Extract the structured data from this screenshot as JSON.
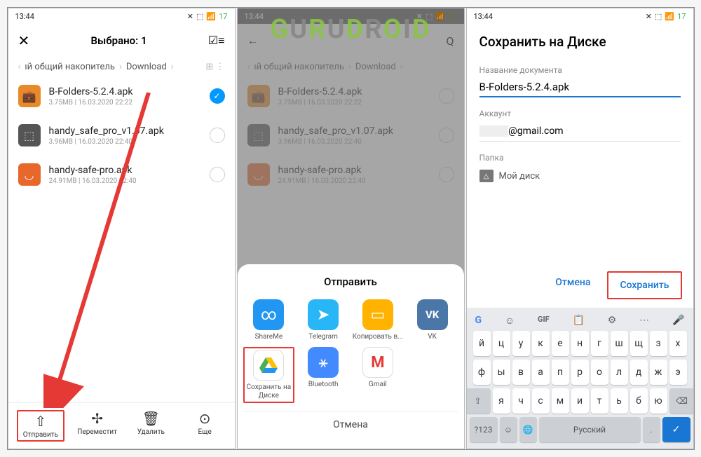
{
  "status": {
    "time": "13:44",
    "bat": "17"
  },
  "screen1": {
    "title": "Выбрано: 1",
    "crumb": [
      "ıй общий накопитель",
      "Download"
    ],
    "files": [
      {
        "name": "B-Folders-5.2.4.apk",
        "meta": "3.75MB | 16.03.2020 22:22",
        "icon": "orange",
        "sel": true
      },
      {
        "name": "handy_safe_pro_v1.07.apk",
        "meta": "3.96MB | 16.03.2020 22:40",
        "icon": "grey",
        "sel": false
      },
      {
        "name": "handy-safe-pro.apk",
        "meta": "24.91MB | 16.03.2020 22:40",
        "icon": "orange2",
        "sel": false
      }
    ],
    "actions": [
      {
        "label": "Отправить"
      },
      {
        "label": "Переместит"
      },
      {
        "label": "Удалить"
      },
      {
        "label": "Еще"
      }
    ]
  },
  "screen2": {
    "sheet_title": "Отправить",
    "apps": [
      {
        "label": "ShareMe",
        "color": "#2196f3",
        "glyph": "∞"
      },
      {
        "label": "Telegram",
        "color": "#29b6f6",
        "glyph": "➤"
      },
      {
        "label": "Копировать в...",
        "color": "#ffb300",
        "glyph": "▭"
      },
      {
        "label": "VK",
        "color": "#4a76a8",
        "glyph": "VK"
      },
      {
        "label": "Сохранить на Диске",
        "color": "#fff",
        "glyph": "△"
      },
      {
        "label": "Bluetooth",
        "color": "#448aff",
        "glyph": "✱"
      },
      {
        "label": "Gmail",
        "color": "#fff",
        "glyph": "M"
      }
    ],
    "cancel": "Отмена"
  },
  "screen3": {
    "title": "Сохранить на Диске",
    "fields": {
      "doc_label": "Название документа",
      "doc_value": "B-Folders-5.2.4.apk",
      "acc_label": "Аккаунт",
      "acc_value": "@gmail.com",
      "folder_label": "Папка",
      "folder_value": "Мой диск"
    },
    "btns": {
      "cancel": "Отмена",
      "save": "Сохранить"
    },
    "kb": {
      "r1": [
        "й",
        "ц",
        "у",
        "к",
        "е",
        "н",
        "г",
        "ш",
        "щ",
        "з",
        "х"
      ],
      "r2": [
        "ф",
        "ы",
        "в",
        "а",
        "п",
        "р",
        "о",
        "л",
        "д",
        "ж",
        "э"
      ],
      "r3": [
        "я",
        "ч",
        "с",
        "м",
        "и",
        "т",
        "ь",
        "б",
        "ю"
      ],
      "lang": "Русский",
      "num": "?123"
    }
  },
  "watermark": "GURUDROID"
}
